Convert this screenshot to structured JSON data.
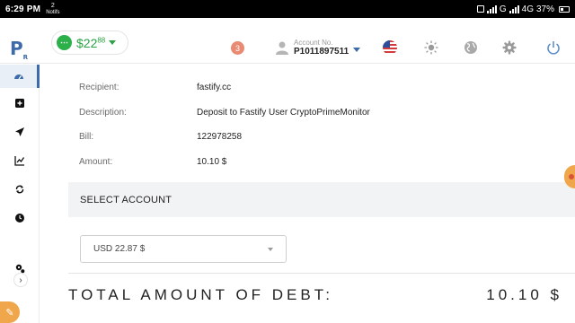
{
  "status_bar": {
    "time": "6:29 PM",
    "notification_count": "2",
    "notification_label": "Notifs",
    "network_g": "G",
    "network_4g": "4G",
    "battery": "37%"
  },
  "header": {
    "logo": "P",
    "logo_sub": "R",
    "balance_main": "$22",
    "balance_cents": "88",
    "notification_badge": "3",
    "account_label": "Account No.",
    "account_number": "P1011897511",
    "accent_color": "#3d6aa8",
    "balance_color": "#2aa245"
  },
  "sidebar": {
    "items": [
      {
        "icon": "dashboard-icon",
        "active": true
      },
      {
        "icon": "plus-square-icon",
        "active": false
      },
      {
        "icon": "send-icon",
        "active": false
      },
      {
        "icon": "chart-icon",
        "active": false
      },
      {
        "icon": "exchange-icon",
        "active": false
      },
      {
        "icon": "clock-icon",
        "active": false
      },
      {
        "icon": "settings-icon",
        "active": false
      }
    ],
    "expand_glyph": "›"
  },
  "payment": {
    "recipient_label": "Recipient:",
    "recipient_value": "fastify.cc",
    "description_label": "Description:",
    "description_value": "Deposit to Fastify User CryptoPrimeMonitor",
    "bill_label": "Bill:",
    "bill_value": "122978258",
    "amount_label": "Amount:",
    "amount_value": "10.10 $"
  },
  "select_account": {
    "title": "SELECT ACCOUNT",
    "selected_value": "USD 22.87 $"
  },
  "total": {
    "label": "TOTAL AMOUNT OF DEBT:",
    "value": "10.10 $"
  }
}
